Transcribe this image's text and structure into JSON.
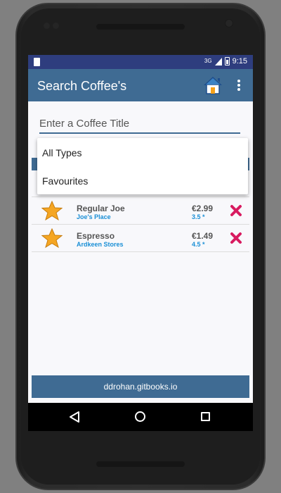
{
  "status_bar": {
    "network": "3G",
    "time": "9:15"
  },
  "app_bar": {
    "title": "Search Coffee's",
    "home_icon": "home-icon",
    "menu_icon": "overflow-menu-icon"
  },
  "search": {
    "placeholder": "Enter a Coffee Title",
    "value": ""
  },
  "dropdown": {
    "options": [
      "All Types",
      "Favourites"
    ]
  },
  "coffees": [
    {
      "name": "Regular Joe",
      "shop": "Joe's Place",
      "price": "€2.99",
      "rating": "3.5 *",
      "favourite": true
    },
    {
      "name": "Espresso",
      "shop": "Ardkeen Stores",
      "price": "€1.49",
      "rating": "4.5 *",
      "favourite": true
    }
  ],
  "footer": {
    "text": "ddrohan.gitbooks.io"
  },
  "colors": {
    "status_bar": "#2e3d7e",
    "primary": "#3f6b93",
    "link": "#1a8fd6",
    "delete": "#d81b60",
    "star": "#f5a623"
  }
}
